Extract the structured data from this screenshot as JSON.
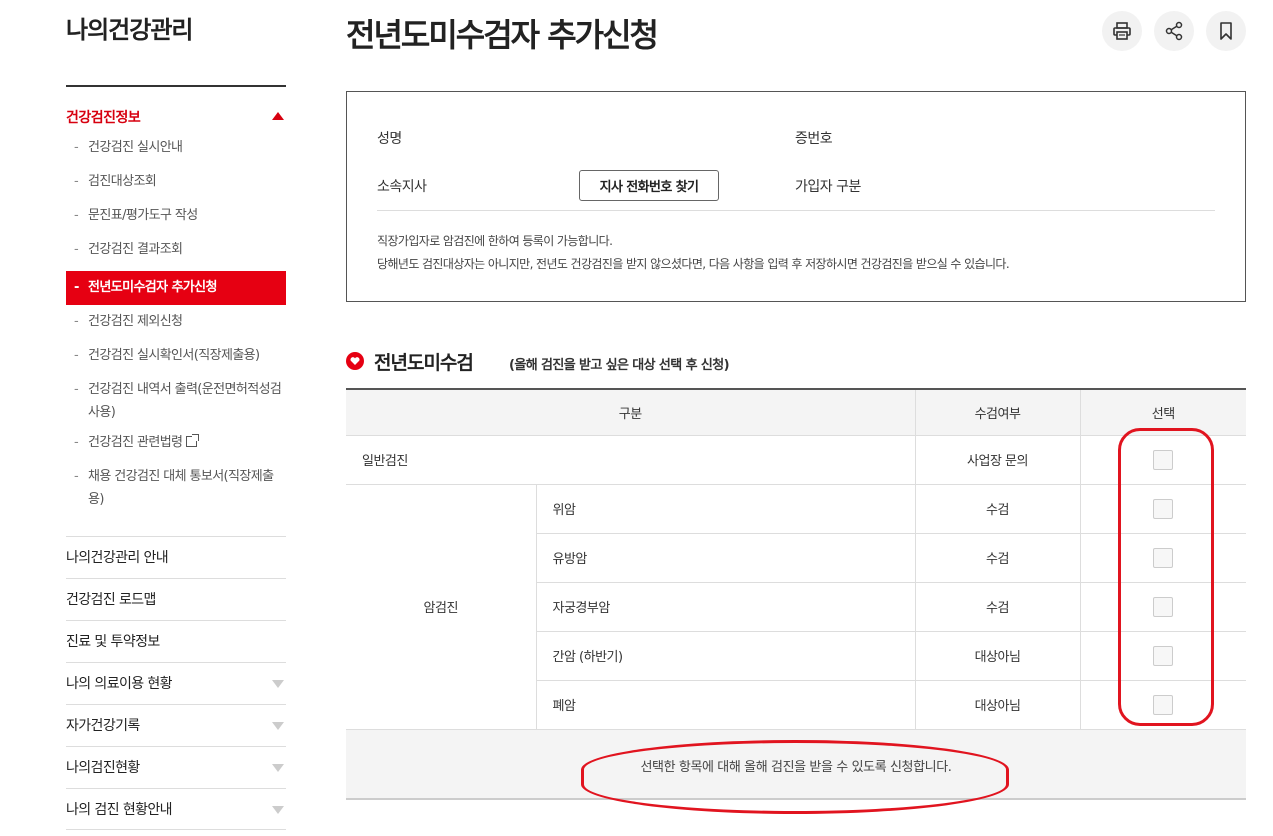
{
  "sidebar": {
    "title": "나의건강관리",
    "section": "건강검진정보",
    "sub_items": [
      {
        "label": "건강검진 실시안내"
      },
      {
        "label": "검진대상조회"
      },
      {
        "label": "문진표/평가도구 작성"
      },
      {
        "label": "건강검진 결과조회"
      },
      {
        "label": "전년도미수검자 추가신청",
        "active": true
      },
      {
        "label": "건강검진 제외신청"
      },
      {
        "label": "건강검진 실시확인서(직장제출용)"
      },
      {
        "label": "건강검진 내역서 출력(운전면허적성검사용)"
      },
      {
        "label": "건강검진 관련법령"
      },
      {
        "label": "채용 건강검진 대체 통보서(직장제출용)"
      }
    ],
    "main_items": [
      {
        "label": "나의건강관리 안내"
      },
      {
        "label": "건강검진 로드맵"
      },
      {
        "label": "진료 및 투약정보"
      },
      {
        "label": "나의 의료이용 현황"
      },
      {
        "label": "자가건강기록"
      },
      {
        "label": "나의검진현황"
      },
      {
        "label": "나의 검진 현황안내"
      }
    ]
  },
  "header": {
    "title": "전년도미수검자 추가신청",
    "tools": [
      "print-icon",
      "share-icon",
      "bookmark-icon"
    ]
  },
  "info": {
    "name_label": "성명",
    "id_label": "증번호",
    "branch_label": "소속지사",
    "branch_button": "지사 전화번호 찾기",
    "member_type_label": "가입자 구분",
    "note_1": "직장가입자로 암검진에 한하여 등록이 가능합니다.",
    "note_2": "당해년도 검진대상자는 아니지만, 전년도 건강검진을 받지 않으셨다면, 다음 사항을 입력 후 저장하시면 건강검진을 받으실 수 있습니다."
  },
  "section": {
    "title": "전년도미수검",
    "subtitle": "(올해 검진을 받고 싶은 대상 선택 후 신청)"
  },
  "table": {
    "headers": [
      "구분",
      "수검여부",
      "선택"
    ],
    "general": {
      "label": "일반검진",
      "status": "사업장 문의"
    },
    "cancer_group": "암검진",
    "cancer_rows": [
      {
        "label": "위암",
        "status": "수검"
      },
      {
        "label": "유방암",
        "status": "수검"
      },
      {
        "label": "자궁경부암",
        "status": "수검"
      },
      {
        "label": "간암 (하반기)",
        "status": "대상아님"
      },
      {
        "label": "폐암",
        "status": "대상아님"
      }
    ],
    "footer_note": "선택한 항목에 대해 올해 검진을 받을 수 있도록 신청합니다."
  },
  "colors": {
    "accent": "#e60012",
    "annotation": "#e1141f"
  }
}
